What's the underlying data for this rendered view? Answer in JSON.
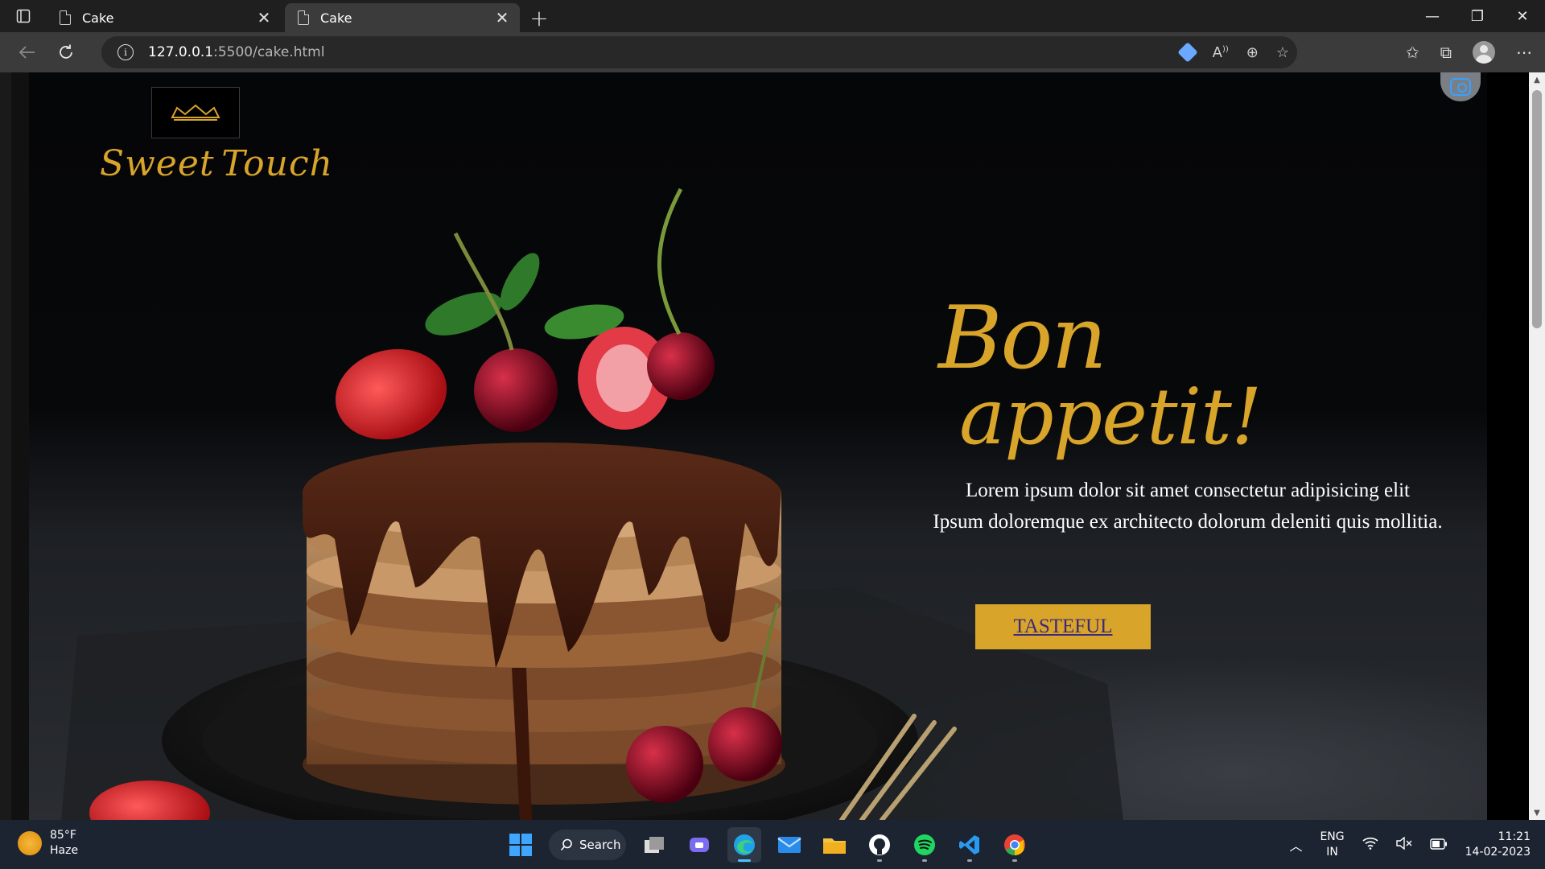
{
  "browser": {
    "tabs": [
      {
        "title": "Cake",
        "active": false
      },
      {
        "title": "Cake",
        "active": true
      }
    ],
    "new_tab": "+",
    "url_host": "127.0.0.1",
    "url_path": ":5500/cake.html",
    "window_controls": {
      "minimize": "—",
      "restore": "❐",
      "close": "✕"
    }
  },
  "page": {
    "brand": {
      "word1": "Sweet",
      "word2": "Touch",
      "logo_icon": "crown-icon"
    },
    "hero": {
      "title_line1": "Bon",
      "title_line2": "appetit!",
      "text_line1": "Lorem ipsum dolor sit amet consectetur adipisicing elit",
      "text_line2": "Ipsum doloremque ex architecto dolorum deleniti quis mollitia.",
      "cta_label": "TASTEFUL"
    },
    "colors": {
      "accent": "#d9a42a",
      "cta_text": "#3a2a7a",
      "background": "#07080a"
    }
  },
  "taskbar": {
    "weather": {
      "temp": "85°F",
      "condition": "Haze"
    },
    "search_label": "Search",
    "apps": [
      "start-icon",
      "search",
      "task-view-icon",
      "teams-chat-icon",
      "edge-icon",
      "mail-icon",
      "file-explorer-icon",
      "github-icon",
      "spotify-icon",
      "vscode-icon",
      "chrome-icon"
    ],
    "language": {
      "line1": "ENG",
      "line2": "IN"
    },
    "clock": {
      "time": "11:21",
      "date": "14-02-2023"
    }
  }
}
